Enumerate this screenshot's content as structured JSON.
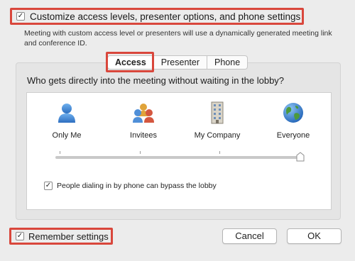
{
  "options": {
    "customize_label": "Customize access levels, presenter options, and phone settings",
    "customize_checked": true,
    "description": "Meeting with custom access level or presenters will use a dynamically generated meeting link and conference ID."
  },
  "tabs": [
    {
      "label": "Access",
      "active": true
    },
    {
      "label": "Presenter",
      "active": false
    },
    {
      "label": "Phone",
      "active": false
    }
  ],
  "access": {
    "question": "Who gets directly into the meeting without waiting in the lobby?",
    "levels": [
      {
        "label": "Only Me",
        "icon": "person-icon"
      },
      {
        "label": "Invitees",
        "icon": "group-icon"
      },
      {
        "label": "My Company",
        "icon": "building-icon"
      },
      {
        "label": "Everyone",
        "icon": "globe-icon"
      }
    ],
    "selected_level": "Everyone",
    "phone_bypass_label": "People dialing in by phone can bypass the lobby",
    "phone_bypass_checked": true
  },
  "footer": {
    "remember_label": "Remember settings",
    "remember_checked": true,
    "cancel_label": "Cancel",
    "ok_label": "OK"
  },
  "colors": {
    "highlight": "#d9473c",
    "accent": "#3b7fd1"
  }
}
